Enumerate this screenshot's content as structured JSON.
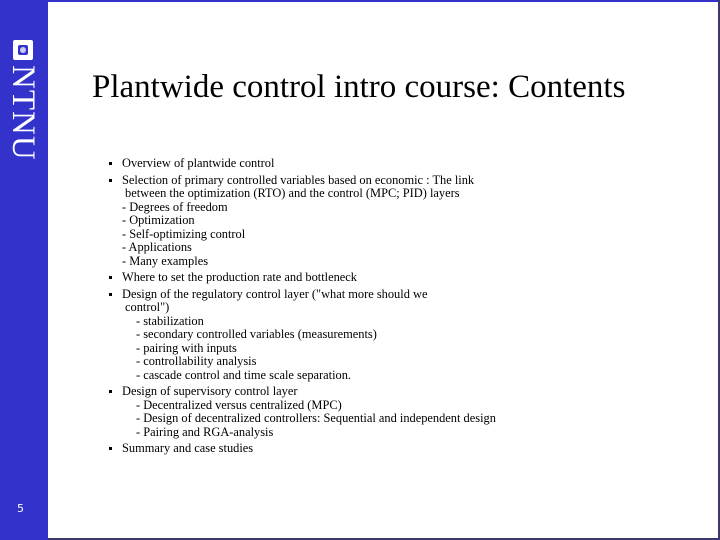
{
  "sidebar": {
    "logo_text": "NTNU",
    "page_number": "5",
    "color": "#3333cc"
  },
  "title": "Plantwide control intro course: Contents",
  "items": [
    {
      "lines": [
        "Overview of plantwide control"
      ],
      "subs": []
    },
    {
      "lines": [
        "Selection of primary controlled variables based on economic : The link",
        "between the optimization (RTO) and the control (MPC; PID) layers"
      ],
      "subs": [
        "- Degrees of freedom",
        "- Optimization",
        "- Self-optimizing control",
        "- Applications",
        "- Many examples"
      ]
    },
    {
      "lines": [
        "Where to set the production rate and bottleneck"
      ],
      "subs": []
    },
    {
      "lines": [
        "Design of the regulatory control layer (\"what more should we",
        "control\")"
      ],
      "subs": [
        "- stabilization",
        "- secondary controlled variables (measurements)",
        "- pairing with inputs",
        "- controllability analysis",
        "- cascade control and time scale separation."
      ]
    },
    {
      "lines": [
        "Design of supervisory control layer"
      ],
      "subs": [
        "- Decentralized versus centralized (MPC)",
        "- Design of decentralized controllers: Sequential and independent design",
        "- Pairing and RGA-analysis"
      ]
    },
    {
      "lines": [
        "Summary and case studies"
      ],
      "subs": []
    }
  ]
}
